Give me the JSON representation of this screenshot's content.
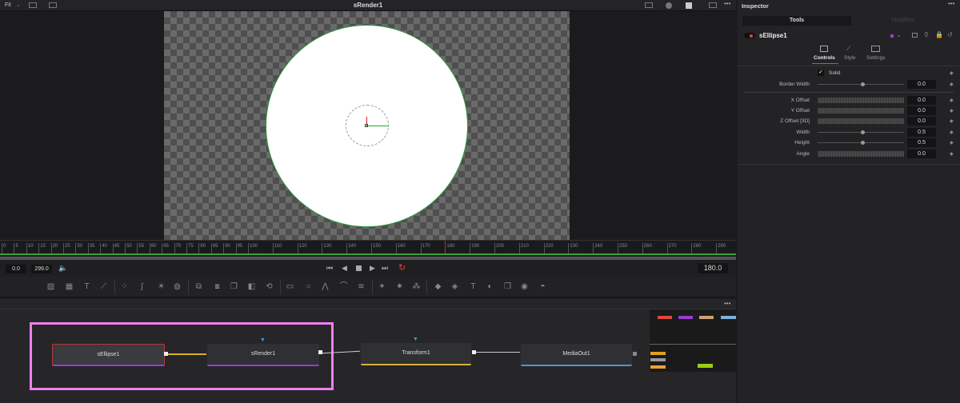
{
  "viewer": {
    "title": "sRender1",
    "zoom": "Fit"
  },
  "ruler": {
    "labels": [
      0,
      5,
      10,
      15,
      20,
      25,
      30,
      35,
      40,
      45,
      50,
      55,
      60,
      65,
      70,
      75,
      80,
      85,
      90,
      95,
      100,
      110,
      120,
      130,
      140,
      150,
      160,
      170,
      180,
      190,
      200,
      210,
      220,
      230,
      240,
      250,
      260,
      270,
      280,
      290
    ],
    "playhead": 180,
    "end": 299
  },
  "transport": {
    "start": "0.0",
    "end": "299.0",
    "current": "180.0"
  },
  "nodes": [
    {
      "label": "sEllipse1",
      "color": "#9a3bd0"
    },
    {
      "label": "sRender1",
      "color": "#9a3bd0"
    },
    {
      "label": "Transform1",
      "color": "#d9b03a"
    },
    {
      "label": "MediaOut1",
      "color": "#5a8fd0"
    }
  ],
  "inspector": {
    "title": "Inspector",
    "tabs": [
      "Tools",
      "Modifiers"
    ],
    "tool_name": "sEllipse1",
    "subtabs": [
      "Controls",
      "Style",
      "Settings"
    ],
    "solid_label": "Solid",
    "params": [
      {
        "label": "Border Width",
        "value": "0.0",
        "type": "slider",
        "pos": 0.5
      },
      {
        "label": "X Offset",
        "value": "0.0",
        "type": "jog"
      },
      {
        "label": "Y Offset",
        "value": "0.0",
        "type": "jog"
      },
      {
        "label": "Z Offset [3D]",
        "value": "0.0",
        "type": "jog"
      },
      {
        "label": "Width",
        "value": "0.5",
        "type": "slider",
        "pos": 0.5
      },
      {
        "label": "Height",
        "value": "0.5",
        "type": "slider",
        "pos": 0.5
      },
      {
        "label": "Angle",
        "value": "0.0",
        "type": "jog"
      }
    ]
  },
  "colors": {
    "accent": "#e0463a",
    "selection": "#f07ff0",
    "swatches": [
      "#e0463a",
      "#9a3bd0",
      "#c9a07a",
      "#7fb0dc",
      "#e0a020",
      "#999999",
      "#f0a030",
      "#9acd10"
    ]
  }
}
